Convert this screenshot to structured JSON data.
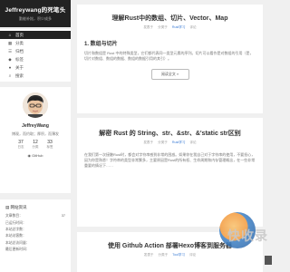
{
  "site": {
    "title": "Jeffreywang的死笔头",
    "subtitle": "勤能补拙，积少成多"
  },
  "nav": [
    {
      "label": "首页",
      "icon": "home-icon",
      "glyph": "⌂",
      "active": true
    },
    {
      "label": "分类",
      "icon": "grid-icon",
      "glyph": "▦"
    },
    {
      "label": "归档",
      "icon": "archive-icon",
      "glyph": "☰"
    },
    {
      "label": "标签",
      "icon": "tag-icon",
      "glyph": "◆"
    },
    {
      "label": "关于",
      "icon": "user-icon",
      "glyph": "●"
    },
    {
      "label": "搜索",
      "icon": "search-icon",
      "glyph": "⌕"
    }
  ],
  "profile": {
    "name": "JeffreyWang",
    "desc": "博观，而约取；厚积，而薄发",
    "stats": [
      {
        "num": "37",
        "label": "日志"
      },
      {
        "num": "12",
        "label": "分类"
      },
      {
        "num": "33",
        "label": "标签"
      }
    ],
    "github": "GitHub"
  },
  "info": {
    "title": "网站资讯",
    "rows": [
      {
        "k": "文章数目：",
        "v": "37"
      },
      {
        "k": "已运行时间：",
        "v": ""
      },
      {
        "k": "本站总字数：",
        "v": ""
      },
      {
        "k": "本站访客数：",
        "v": ""
      },
      {
        "k": "本站总访问量：",
        "v": ""
      },
      {
        "k": "最后更新时间：",
        "v": ""
      }
    ]
  },
  "posts": [
    {
      "title": "理解Rust中的数组、切片、Vector、Map",
      "meta": [
        "发表于",
        "分类于",
        "Rust学习",
        "评论"
      ],
      "h2": "1. 数组与切片",
      "body": "切片和数组是 Rust 中的特殊类型，它们都代表同一类型元素的序列。切片可以看作是对数组的引用（是，切片对数组、数组的数据、数组的数据引用的其引）。",
      "read_more": "阅读全文 »"
    },
    {
      "title": "解密 Rust 的 String、str、&str、&'static str区别",
      "meta": [
        "发表于",
        "分类于",
        "Rust学习",
        "评论"
      ],
      "body": "在我们第一次接触Rust时，都会对字符串感到非常的困惑。如果你在我自己对于字符串的使用，不要担心，因为你是熟悉！字符串的类型非常繁多，主要原因是Rust的所有权、生命周期和内存管理概念，在一些非常重要的情况下……",
      "read_more": ""
    },
    {
      "title": "使用 Github Action 部署Hexo博客到服务器",
      "meta": [
        "发表于",
        "分类于",
        "Tool学习",
        "评论"
      ],
      "body": "",
      "read_more": ""
    }
  ],
  "watermark": "快收录"
}
